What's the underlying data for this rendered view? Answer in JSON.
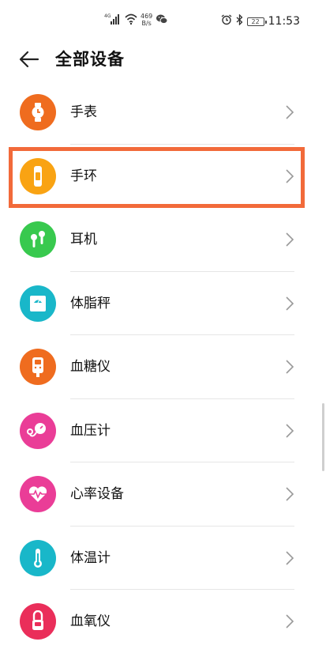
{
  "status_bar": {
    "net_speed_value": "469",
    "net_speed_unit": "B/s",
    "network_type": "4G",
    "battery": "22",
    "time": "11:53"
  },
  "header": {
    "title": "全部设备"
  },
  "devices": [
    {
      "label": "手表",
      "icon": "watch-icon",
      "color": "#ef6c1f"
    },
    {
      "label": "手环",
      "icon": "band-icon",
      "color": "#f9a313"
    },
    {
      "label": "耳机",
      "icon": "earphones-icon",
      "color": "#38c94e"
    },
    {
      "label": "体脂秤",
      "icon": "scale-icon",
      "color": "#19b7c9"
    },
    {
      "label": "血糖仪",
      "icon": "glucose-meter-icon",
      "color": "#ef6c1f"
    },
    {
      "label": "血压计",
      "icon": "blood-pressure-icon",
      "color": "#ea3d97"
    },
    {
      "label": "心率设备",
      "icon": "heart-rate-icon",
      "color": "#ea3d97"
    },
    {
      "label": "体温计",
      "icon": "thermometer-icon",
      "color": "#19b7c9"
    },
    {
      "label": "血氧仪",
      "icon": "oximeter-icon",
      "color": "#ea2e5a"
    }
  ],
  "highlight_color": "#f26a3a"
}
